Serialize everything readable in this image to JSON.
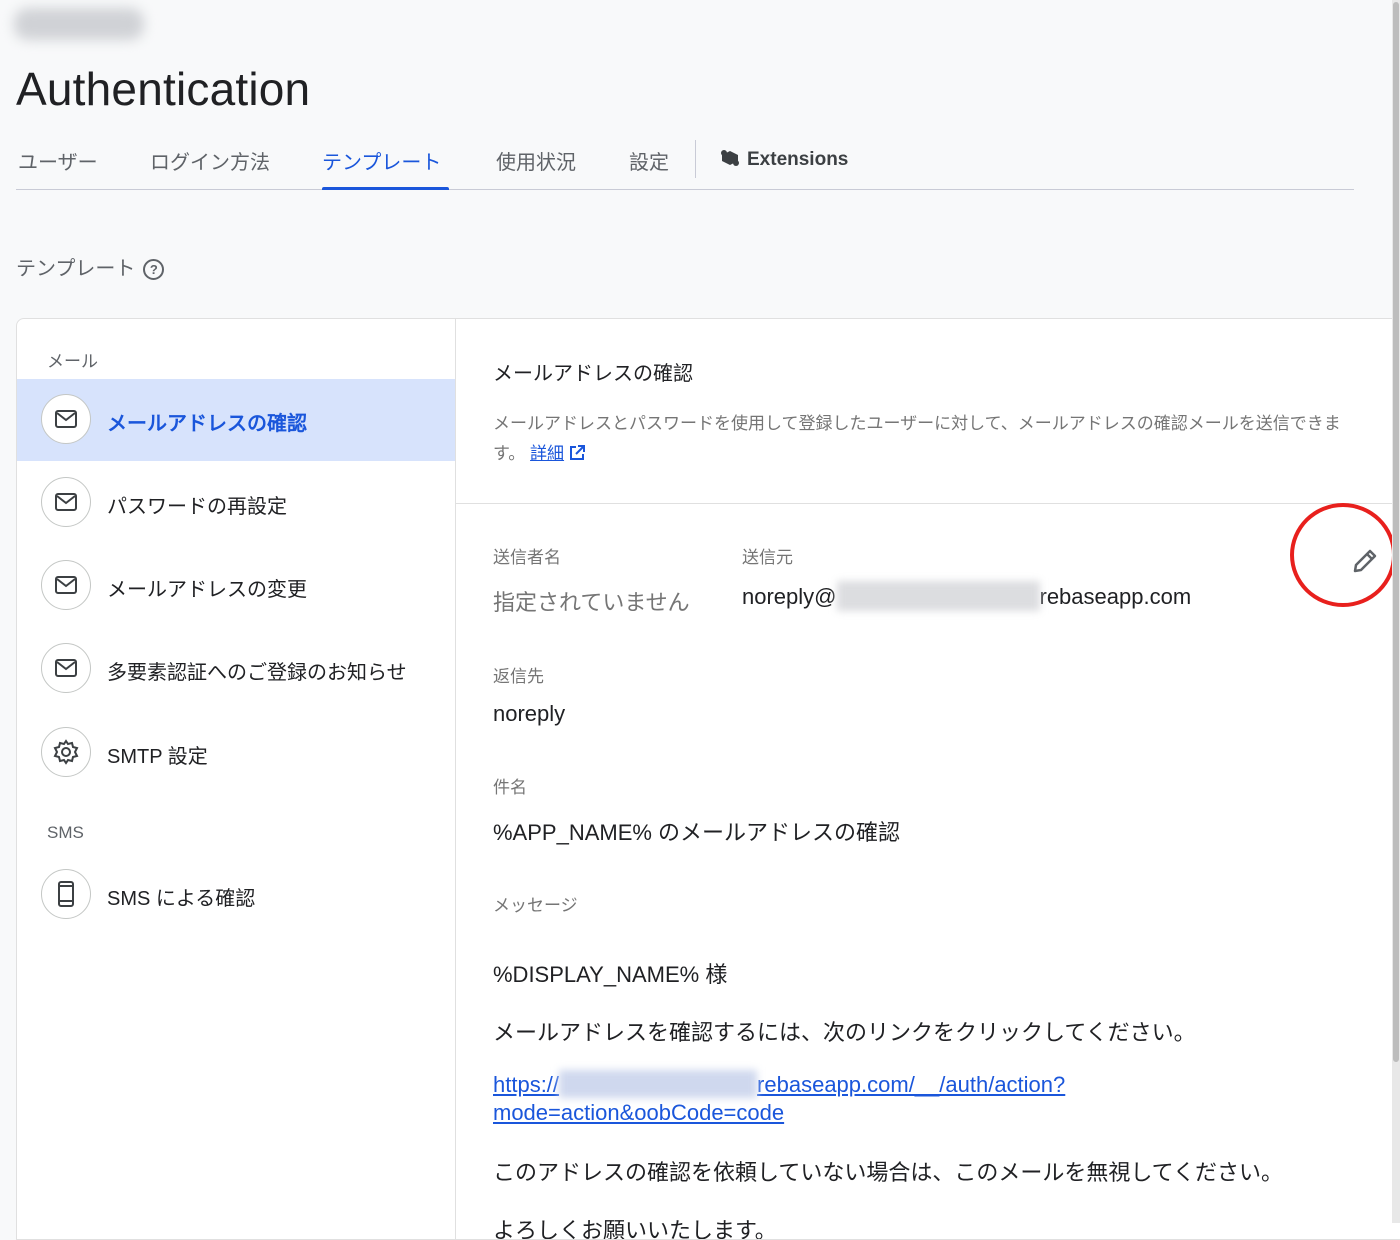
{
  "page": {
    "title": "Authentication",
    "section_title": "テンプレート"
  },
  "tabs": [
    {
      "label": "ユーザー"
    },
    {
      "label": "ログイン方法"
    },
    {
      "label": "テンプレート",
      "active": true
    },
    {
      "label": "使用状況"
    },
    {
      "label": "設定"
    },
    {
      "label": "Extensions"
    }
  ],
  "sidebar": {
    "email_group": "メール",
    "sms_group": "SMS",
    "items": [
      {
        "label": "メールアドレスの確認",
        "icon": "mail-icon",
        "active": true
      },
      {
        "label": "パスワードの再設定",
        "icon": "mail-icon"
      },
      {
        "label": "メールアドレスの変更",
        "icon": "mail-icon"
      },
      {
        "label": "多要素認証へのご登録のお知らせ",
        "icon": "mail-icon"
      },
      {
        "label": "SMTP 設定",
        "icon": "gear-icon"
      },
      {
        "label": "SMS による確認",
        "icon": "phone-icon"
      }
    ]
  },
  "template": {
    "title": "メールアドレスの確認",
    "description": "メールアドレスとパスワードを使用して登録したユーザーに対して、メールアドレスの確認メールを送信できます。",
    "details_link": "詳細",
    "sender_name_label": "送信者名",
    "sender_name_value": "指定されていません",
    "from_label": "送信元",
    "from_prefix": "noreply@",
    "from_suffix": "rebaseapp.com",
    "reply_to_label": "返信先",
    "reply_to_value": "noreply",
    "subject_label": "件名",
    "subject_value": "%APP_NAME% のメールアドレスの確認",
    "message_label": "メッセージ",
    "message_greeting": "%DISPLAY_NAME% 様",
    "message_line1": "メールアドレスを確認するには、次のリンクをクリックしてください。",
    "message_link_prefix": "https://",
    "message_link_suffix": "rebaseapp.com/__/auth/action?",
    "message_link_line2": "mode=action&oobCode=code",
    "message_line2": "このアドレスの確認を依頼していない場合は、このメールを無視してください。",
    "message_line3": "よろしくお願いいたします。"
  },
  "colors": {
    "accent": "#1a56db",
    "active_bg": "#d7e3fc",
    "annotation": "#e8201d"
  }
}
